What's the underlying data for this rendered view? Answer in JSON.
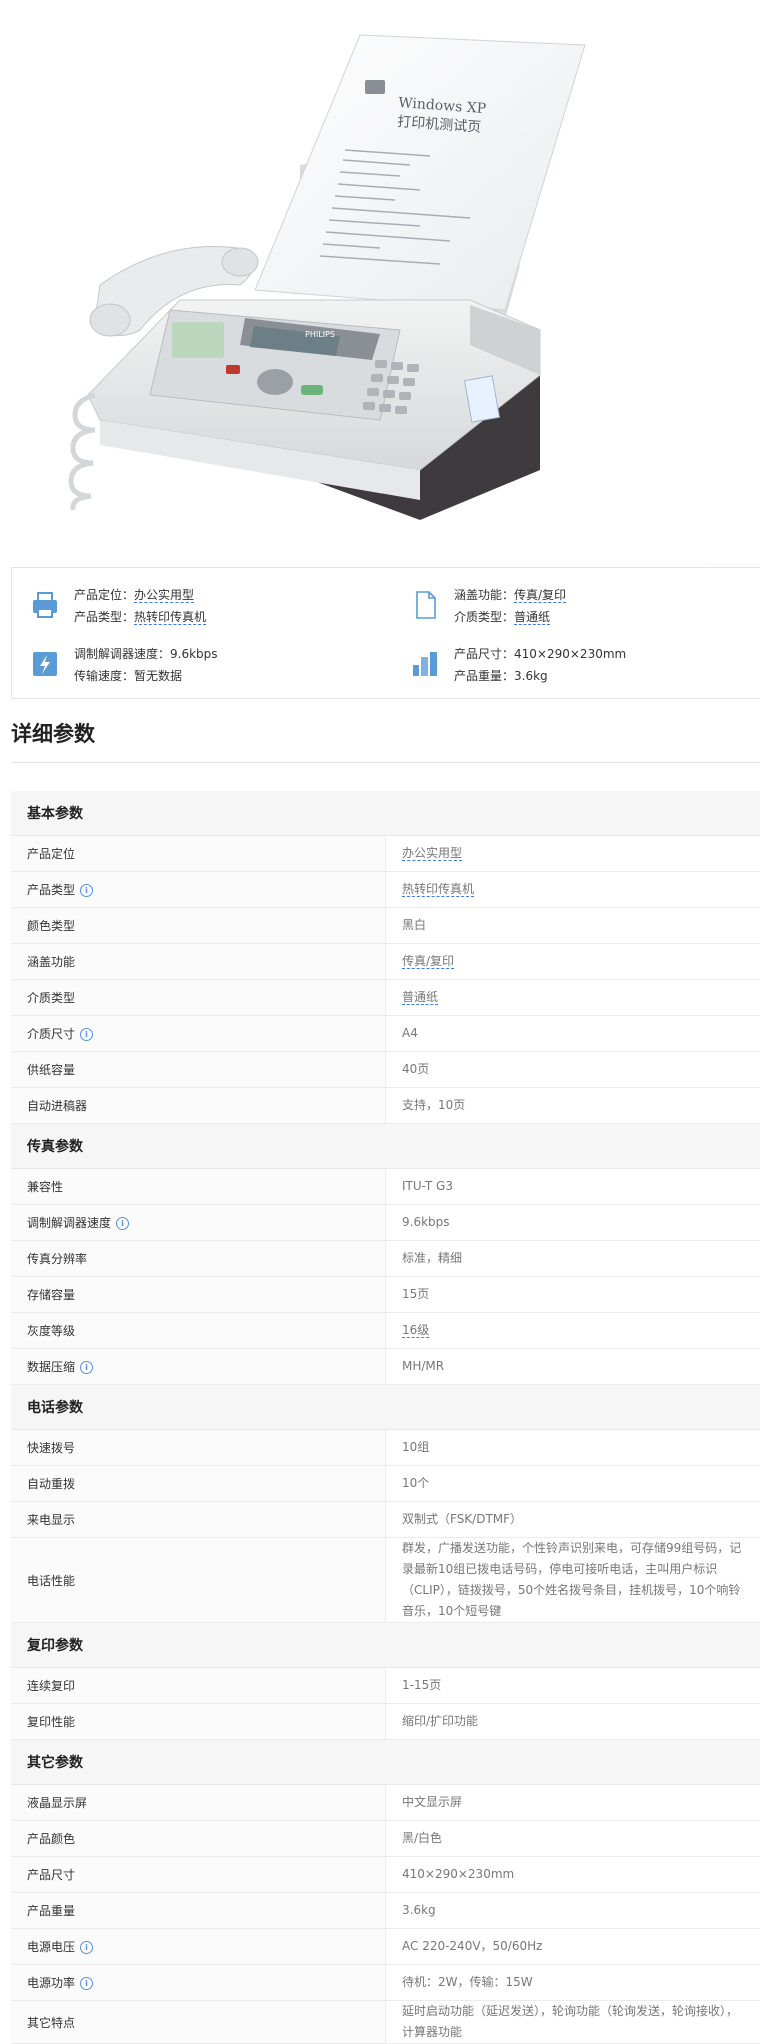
{
  "hero": {
    "paper_line1": "Windows XP",
    "paper_line2": "打印机测试页",
    "brand": "PHILIPS"
  },
  "summary": [
    {
      "icon": "fax-machine-icon",
      "lines": [
        {
          "label": "产品定位：",
          "value": "办公实用型",
          "link": true
        },
        {
          "label": "产品类型：",
          "value": "热转印传真机",
          "link": true
        }
      ]
    },
    {
      "icon": "document-icon",
      "lines": [
        {
          "label": "涵盖功能：",
          "value": "传真/复印",
          "link": true
        },
        {
          "label": "介质类型：",
          "value": "普通纸",
          "link": true
        }
      ]
    },
    {
      "icon": "lightning-icon",
      "lines": [
        {
          "label": "调制解调器速度：",
          "value": "9.6kbps",
          "link": false
        },
        {
          "label": "传输速度：",
          "value": "暂无数据",
          "link": false
        }
      ]
    },
    {
      "icon": "buildings-size-icon",
      "lines": [
        {
          "label": "产品尺寸：",
          "value": "410×290×230mm",
          "link": false
        },
        {
          "label": "产品重量：",
          "value": "3.6kg",
          "link": false
        }
      ]
    }
  ],
  "detail_title": "详细参数",
  "groups": [
    {
      "name": "基本参数",
      "rows": [
        {
          "k": "产品定位",
          "v": "办公实用型",
          "link": true
        },
        {
          "k": "产品类型",
          "v": "热转印传真机",
          "link": true,
          "info": true
        },
        {
          "k": "颜色类型",
          "v": "黑白"
        },
        {
          "k": "涵盖功能",
          "v": "传真/复印",
          "link": true
        },
        {
          "k": "介质类型",
          "v": "普通纸",
          "link": true
        },
        {
          "k": "介质尺寸",
          "v": "A4",
          "info": true
        },
        {
          "k": "供纸容量",
          "v": "40页"
        },
        {
          "k": "自动进稿器",
          "v": "支持，10页"
        }
      ]
    },
    {
      "name": "传真参数",
      "rows": [
        {
          "k": "兼容性",
          "v": "ITU-T G3"
        },
        {
          "k": "调制解调器速度",
          "v": "9.6kbps",
          "info": true
        },
        {
          "k": "传真分辨率",
          "v": "标准，精细"
        },
        {
          "k": "存储容量",
          "v": "15页"
        },
        {
          "k": "灰度等级",
          "v": "16级",
          "link": true
        },
        {
          "k": "数据压缩",
          "v": "MH/MR",
          "info": true
        }
      ]
    },
    {
      "name": "电话参数",
      "rows": [
        {
          "k": "快速拨号",
          "v": "10组"
        },
        {
          "k": "自动重拨",
          "v": "10个"
        },
        {
          "k": "来电显示",
          "v": "双制式（FSK/DTMF）"
        },
        {
          "k": "电话性能",
          "v": "群发，广播发送功能，个性铃声识别来电，可存储99组号码，记录最新10组已拨电话号码，停电可接听电话，主叫用户标识（CLIP），链拨拨号，50个姓名拨号条目，挂机拨号，10个响铃音乐，10个短号键",
          "tall": true
        }
      ]
    },
    {
      "name": "复印参数",
      "rows": [
        {
          "k": "连续复印",
          "v": "1-15页"
        },
        {
          "k": "复印性能",
          "v": "缩印/扩印功能"
        }
      ]
    },
    {
      "name": "其它参数",
      "rows": [
        {
          "k": "液晶显示屏",
          "v": "中文显示屏"
        },
        {
          "k": "产品颜色",
          "v": "黑/白色"
        },
        {
          "k": "产品尺寸",
          "v": "410×290×230mm"
        },
        {
          "k": "产品重量",
          "v": "3.6kg"
        },
        {
          "k": "电源电压",
          "v": "AC 220-240V，50/60Hz",
          "info": true
        },
        {
          "k": "电源功率",
          "v": "待机：2W，传输：15W",
          "info": true
        },
        {
          "k": "其它特点",
          "v": "延时启动功能（延迟发送），轮询功能（轮询发送，轮询接收），计算器功能"
        }
      ]
    }
  ],
  "info_glyph": "i",
  "colors": {
    "link": "#3d7be3",
    "icon_blue": "#5b9bd5",
    "group_bg": "#f6f6f6"
  }
}
